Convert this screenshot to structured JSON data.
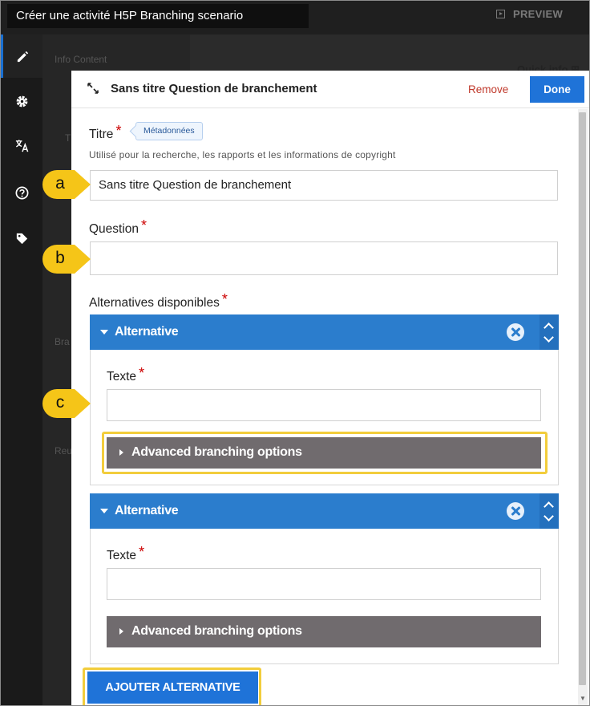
{
  "topbar": {
    "window_title": "Créer une activité H5P Branching scenario",
    "preview_label": "PREVIEW"
  },
  "background": {
    "info_content": "Info Content",
    "quick_info": "Quick info ⊞",
    "t_label": "T",
    "bra": "Bra",
    "reu": "Reu"
  },
  "modal": {
    "title": "Sans titre Question de branchement",
    "remove_label": "Remove",
    "done_label": "Done",
    "titre_label": "Titre",
    "metadata_label": "Métadonnées",
    "titre_desc": "Utilisé pour la recherche, les rapports et les informations de copyright",
    "titre_value": "Sans titre Question de branchement",
    "question_label": "Question",
    "question_value": "",
    "alternatives_label": "Alternatives disponibles",
    "alternatives": [
      {
        "title": "Alternative",
        "text_label": "Texte",
        "text_value": "",
        "advanced_label": "Advanced branching options"
      },
      {
        "title": "Alternative",
        "text_label": "Texte",
        "text_value": "",
        "advanced_label": "Advanced branching options"
      }
    ],
    "add_button_label": "AJOUTER ALTERNATIVE",
    "required_mark": "*"
  },
  "callouts": [
    "a",
    "b",
    "c"
  ],
  "colors": {
    "accent_blue": "#1f73d8",
    "alt_header_blue": "#2b7dcd",
    "advanced_gray": "#706b6e",
    "highlight_yellow": "#f2cd3c",
    "callout_yellow": "#f5c518",
    "remove_red": "#c0392b"
  },
  "icons": {
    "sidebar": [
      "pencil-icon",
      "gear-icon",
      "translate-icon",
      "help-circle-icon",
      "tag-icon"
    ],
    "modal_header": "collapse-arrows-icon",
    "alternative_remove": "close-circle-icon"
  }
}
